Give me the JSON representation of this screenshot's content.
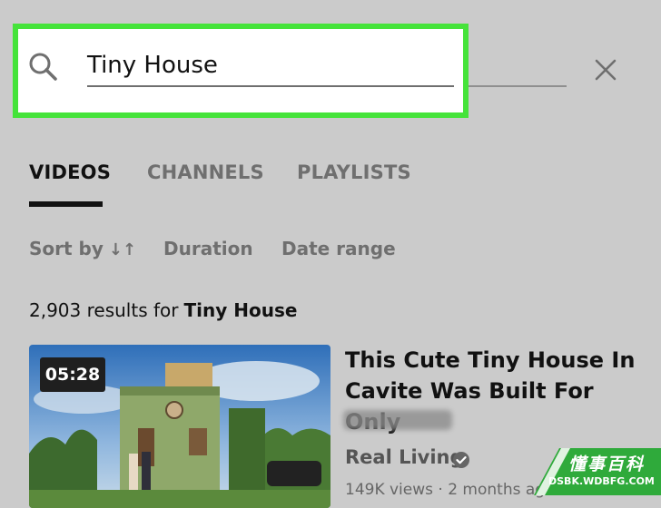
{
  "search": {
    "query": "Tiny House"
  },
  "tabs": [
    {
      "label": "VIDEOS",
      "active": true
    },
    {
      "label": "CHANNELS",
      "active": false
    },
    {
      "label": "PLAYLISTS",
      "active": false
    }
  ],
  "filters": {
    "sort_label": "Sort by",
    "sort_glyph": "↓↑",
    "duration_label": "Duration",
    "date_range_label": "Date range"
  },
  "results": {
    "count_text": "2,903 results for",
    "query": "Tiny House"
  },
  "video": {
    "duration": "05:28",
    "title": "This Cute Tiny House In Cavite Was Built For Only",
    "channel": "Real Living",
    "meta": "149K views · 2 months ago"
  },
  "watermark": {
    "cn": "懂事百科",
    "url": "DSBK.WDBFG.COM"
  },
  "colors": {
    "highlight": "#45e33a",
    "background": "#cbcbcb",
    "watermark_green": "#2faa3b"
  },
  "icons": {
    "search": "search-icon",
    "close": "close-icon",
    "verified": "verified-icon",
    "sort": "sort-icon"
  }
}
